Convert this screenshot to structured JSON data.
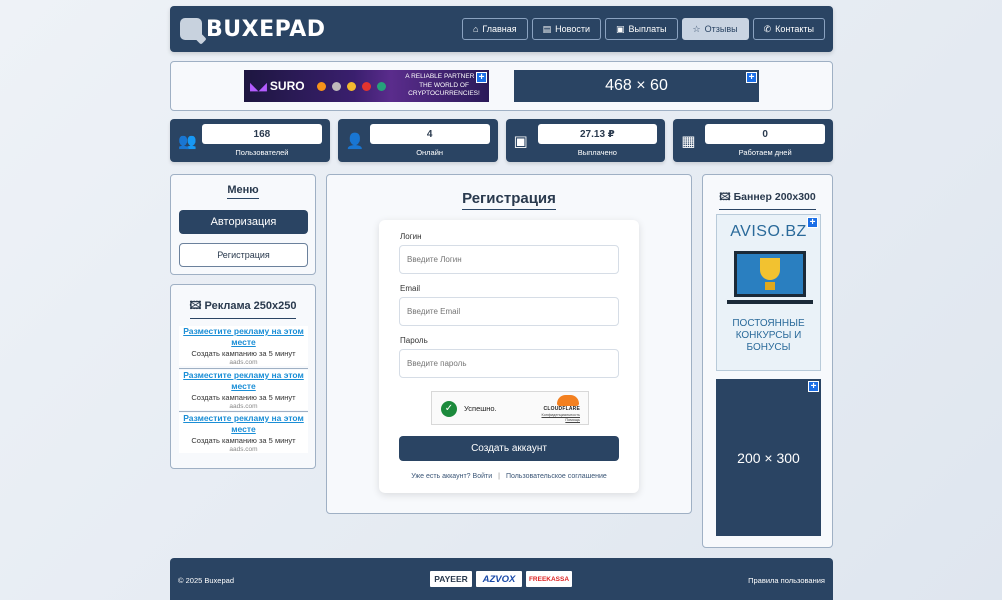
{
  "header": {
    "logo_text": "BUXEPAD",
    "nav": [
      {
        "label": "Главная",
        "icon": "home-icon",
        "active": false
      },
      {
        "label": "Новости",
        "icon": "newspaper-icon",
        "active": false
      },
      {
        "label": "Выплаты",
        "icon": "money-icon",
        "active": false
      },
      {
        "label": "Отзывы",
        "icon": "star-icon",
        "active": true
      },
      {
        "label": "Контакты",
        "icon": "phone-icon",
        "active": false
      }
    ]
  },
  "banners": {
    "suro": {
      "brand": "SURO",
      "text": "A RELIABLE PARTNER IN THE WORLD OF CRYPTOCURRENCIES!"
    },
    "placeholder": "468 × 60"
  },
  "stats": [
    {
      "value": "168",
      "label": "Пользователей",
      "icon": "users-icon"
    },
    {
      "value": "4",
      "label": "Онлайн",
      "icon": "user-check-icon"
    },
    {
      "value": "27.13 ₽",
      "label": "Выплачено",
      "icon": "money-icon"
    },
    {
      "value": "0",
      "label": "Работаем дней",
      "icon": "calendar-icon"
    }
  ],
  "menu": {
    "title": "Меню",
    "login_label": "Авторизация",
    "register_label": "Регистрация"
  },
  "ads": {
    "title": "Реклама 250x250",
    "items": [
      {
        "link": "Разместите рекламу на этом месте",
        "desc": "Создать кампанию за 5 минут",
        "domain": "aads.com"
      },
      {
        "link": "Разместите рекламу на этом месте",
        "desc": "Создать кампанию за 5 минут",
        "domain": "aads.com"
      },
      {
        "link": "Разместите рекламу на этом месте",
        "desc": "Создать кампанию за 5 минут",
        "domain": "aads.com"
      }
    ]
  },
  "registration": {
    "title": "Регистрация",
    "login_label": "Логин",
    "login_placeholder": "Введите Логин",
    "email_label": "Email",
    "email_placeholder": "Введите Email",
    "password_label": "Пароль",
    "password_placeholder": "Введите пароль",
    "captcha_status": "Успешно.",
    "captcha_brand": "CLOUDFLARE",
    "captcha_privacy": "Конфиденциальность",
    "captcha_help": "Помощь",
    "submit_label": "Создать аккаунт",
    "have_account_link": "Уже есть аккаунт? Войти",
    "agreement_link": "Пользовательское соглашение"
  },
  "side_banner": {
    "title": "Баннер 200x300",
    "aviso_name": "AVISO.BZ",
    "aviso_text": "ПОСТОЯННЫЕ КОНКУРСЫ И БОНУСЫ",
    "placeholder": "200 × 300"
  },
  "footer": {
    "copyright": "© 2025 Buxepad",
    "payments": [
      "PAYEER",
      "AZVOX",
      "FREEKASSA"
    ],
    "rules_link": "Правила пользования"
  }
}
